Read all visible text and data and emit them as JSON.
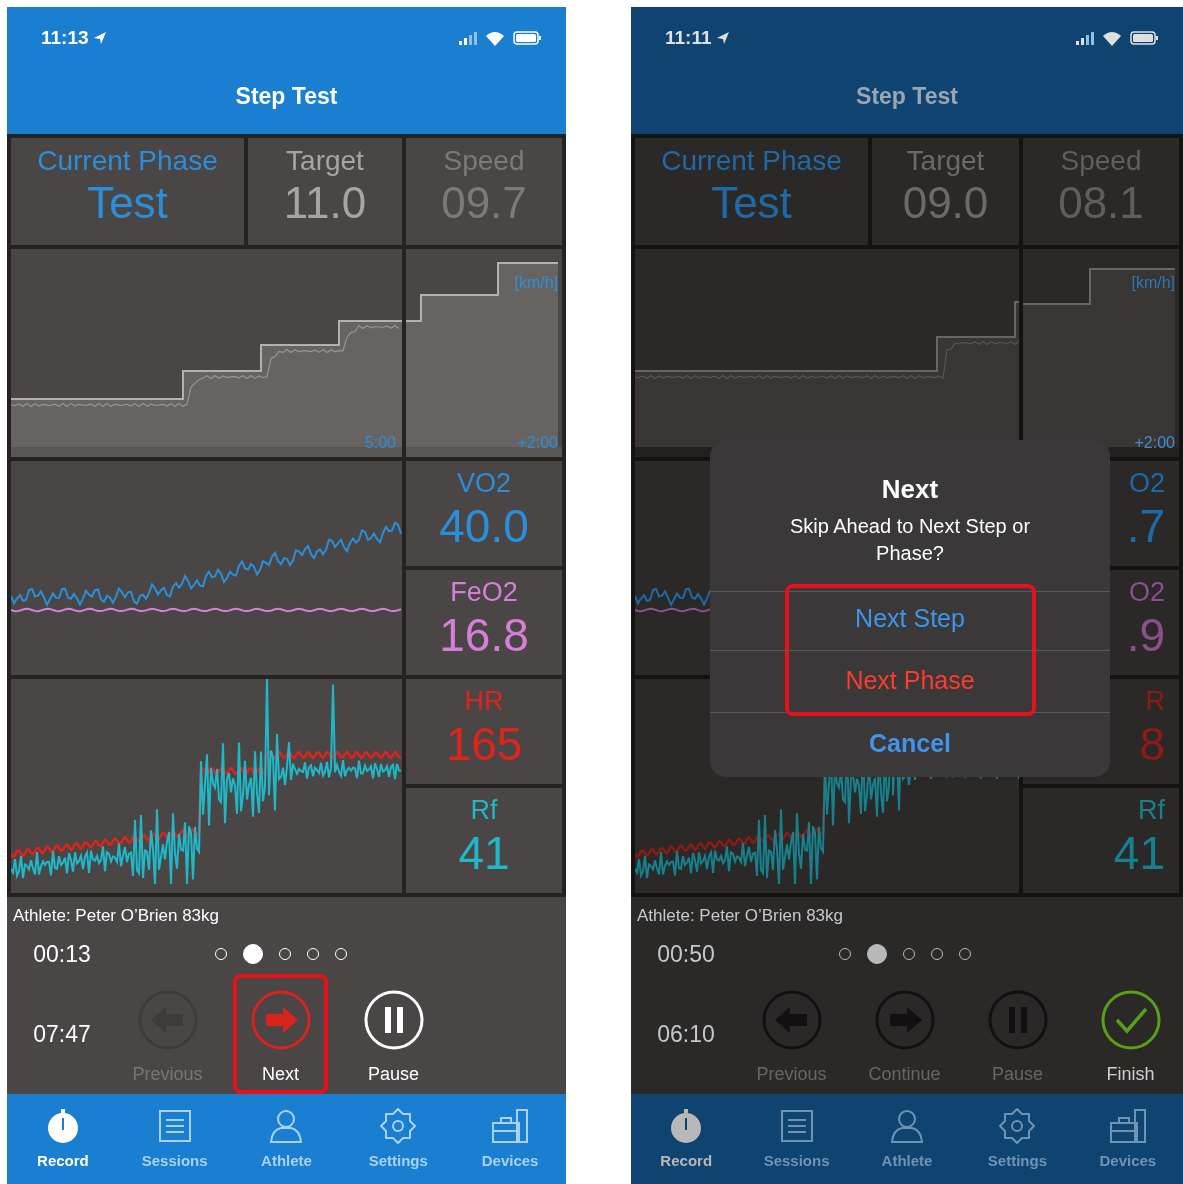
{
  "phones": [
    {
      "status_bar": {
        "time": "11:13"
      },
      "title": "Step Test",
      "dimmed": false,
      "header": [
        {
          "kind": "phase",
          "label": "Current Phase",
          "value": "Test"
        },
        {
          "kind": "target",
          "label": "Target",
          "value": "11.0"
        },
        {
          "kind": "speed",
          "label": "Speed",
          "value": "09.7"
        }
      ],
      "speed_chart": {
        "unit": "[km/h]",
        "history_label": "5:00",
        "forecast_label": "+2:00"
      },
      "metrics": [
        {
          "label": "VO2",
          "value": "40.0",
          "color": "#2a8fd8"
        },
        {
          "label": "FeO2",
          "value": "16.8",
          "color": "#d77fd8"
        },
        {
          "label": "HR",
          "value": "165",
          "color": "#e0231b"
        },
        {
          "label": "Rf",
          "value": "41",
          "color": "#1fb8c8"
        }
      ],
      "athlete": "Athlete: Peter O’Brien 83kg",
      "elapsed": "00:13",
      "remaining": "07:47",
      "pages": [
        {
          "selected": false
        },
        {
          "selected": true
        },
        {
          "selected": false
        },
        {
          "selected": false
        },
        {
          "selected": false
        }
      ],
      "controls": [
        {
          "kind": "previous",
          "label": "Previous",
          "disabled": true,
          "highlighted": false
        },
        {
          "kind": "next",
          "label": "Next",
          "disabled": false,
          "highlighted": true
        },
        {
          "kind": "pause",
          "label": "Pause",
          "disabled": false,
          "highlighted": false
        }
      ],
      "tabs": [
        {
          "kind": "record",
          "label": "Record",
          "selected": true
        },
        {
          "kind": "sessions",
          "label": "Sessions",
          "selected": false
        },
        {
          "kind": "athlete",
          "label": "Athlete",
          "selected": false
        },
        {
          "kind": "settings",
          "label": "Settings",
          "selected": false
        },
        {
          "kind": "devices",
          "label": "Devices",
          "selected": false
        }
      ]
    },
    {
      "status_bar": {
        "time": "11:11"
      },
      "title": "Step Test",
      "dimmed": true,
      "header": [
        {
          "kind": "phase",
          "label": "Current Phase",
          "value": "Test"
        },
        {
          "kind": "target",
          "label": "Target",
          "value": "09.0"
        },
        {
          "kind": "speed",
          "label": "Speed",
          "value": "08.1"
        }
      ],
      "speed_chart": {
        "unit": "[km/h]",
        "forecast_label": "+2:00"
      },
      "metrics": [
        {
          "label": "O2",
          "value": ".7",
          "color": "#1f6aa6"
        },
        {
          "label": "O2",
          "value": ".9",
          "color": "#8a4f8c"
        },
        {
          "label": "R",
          "value": "8",
          "color": "#8c1a15"
        },
        {
          "label": "Rf",
          "value": "41",
          "color": "#16808c"
        }
      ],
      "athlete": "Athlete: Peter O’Brien 83kg",
      "elapsed": "00:50",
      "remaining": "06:10",
      "pages": [
        {
          "selected": false
        },
        {
          "selected": true
        },
        {
          "selected": false
        },
        {
          "selected": false
        },
        {
          "selected": false
        }
      ],
      "controls": [
        {
          "kind": "previous",
          "label": "Previous",
          "disabled": true,
          "highlighted": false
        },
        {
          "kind": "next",
          "label": "Continue",
          "disabled": true,
          "highlighted": false
        },
        {
          "kind": "pause",
          "label": "Pause",
          "disabled": true,
          "highlighted": false
        },
        {
          "kind": "finish",
          "label": "Finish",
          "disabled": false,
          "highlighted": false
        }
      ],
      "tabs": [
        {
          "kind": "record",
          "label": "Record",
          "selected": true
        },
        {
          "kind": "sessions",
          "label": "Sessions",
          "selected": false
        },
        {
          "kind": "athlete",
          "label": "Athlete",
          "selected": false
        },
        {
          "kind": "settings",
          "label": "Settings",
          "selected": false
        },
        {
          "kind": "devices",
          "label": "Devices",
          "selected": false
        }
      ],
      "dialog": {
        "title": "Next",
        "message": "Skip Ahead to Next Step or Phase?",
        "actions": [
          {
            "kind": "default",
            "label": "Next Step",
            "highlighted": true
          },
          {
            "kind": "destructive",
            "label": "Next Phase",
            "highlighted": true
          },
          {
            "kind": "cancel",
            "label": "Cancel",
            "highlighted": false
          }
        ]
      }
    }
  ]
}
